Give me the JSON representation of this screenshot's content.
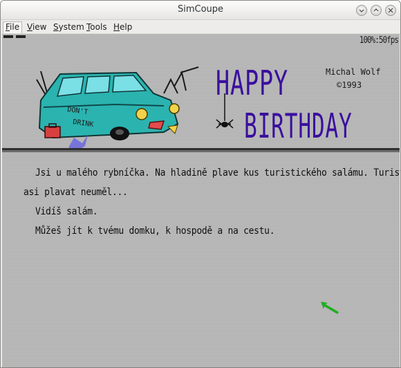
{
  "window": {
    "title": "SimCoupe"
  },
  "menus": [
    {
      "underline": "F",
      "rest": "ile"
    },
    {
      "underline": "V",
      "rest": "iew"
    },
    {
      "underline": "S",
      "rest": "ystem"
    },
    {
      "underline": "T",
      "rest": "ools"
    },
    {
      "underline": "H",
      "rest": "elp"
    }
  ],
  "status": {
    "speed": "100%:50fps"
  },
  "banner": {
    "line1": "HAPPY",
    "line2": "BIRTHDAY",
    "author": "Michal Wolf",
    "year": "©1993",
    "car_sign_1": "DON'T",
    "car_sign_2": "DRINK"
  },
  "story": {
    "line1": "Jsi u malého rybníčka. Na hladině plave kus turistického salámu. Turista",
    "line2": "asi plavat neuměl...",
    "line3": "Vidíš salám.",
    "line4": "Můžeš jít k tvému domku, k hospodě a na cestu."
  },
  "colors": {
    "title_text": "#3a0f9e",
    "car_body": "#2bb3b0",
    "screen_bg": "#bdbdbd",
    "cursor": "#1fae1f"
  }
}
